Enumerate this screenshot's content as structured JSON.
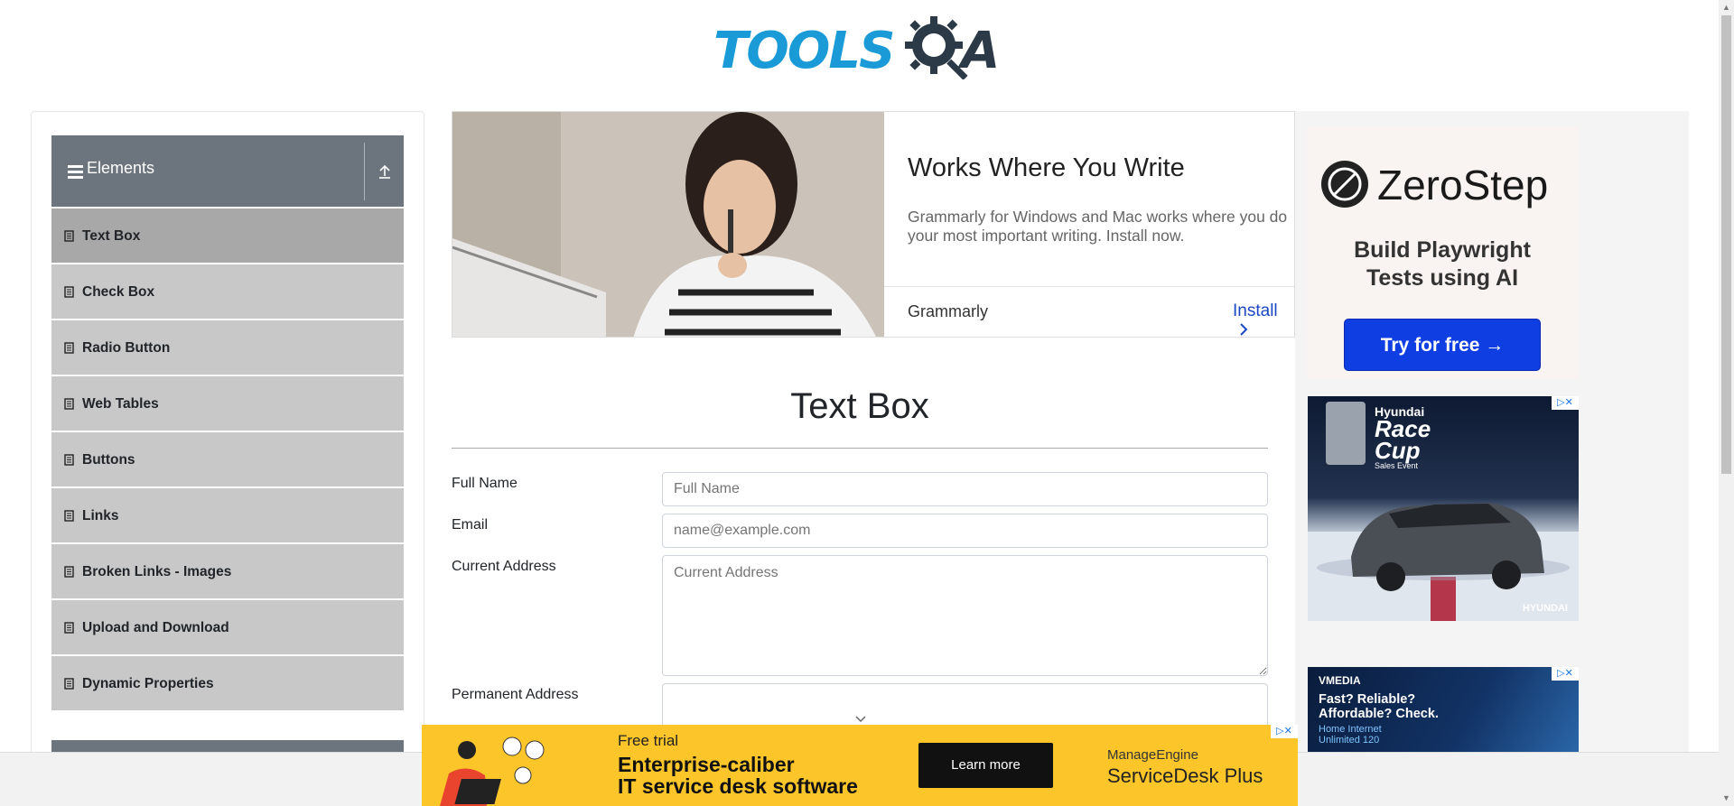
{
  "header": {
    "logo_text": "TOOLS",
    "logo_suffix": "A"
  },
  "sidebar": {
    "group_title": "Elements",
    "items": [
      {
        "label": "Text Box",
        "active": true
      },
      {
        "label": "Check Box"
      },
      {
        "label": "Radio Button"
      },
      {
        "label": "Web Tables"
      },
      {
        "label": "Buttons"
      },
      {
        "label": "Links"
      },
      {
        "label": "Broken Links - Images"
      },
      {
        "label": "Upload and Download"
      },
      {
        "label": "Dynamic Properties"
      }
    ]
  },
  "top_ad": {
    "title": "Works Where You Write",
    "description_line1": "Grammarly for Windows and Mac works where you do",
    "description_line2": "your most important writing. Install now.",
    "brand": "Grammarly",
    "cta": "Install"
  },
  "form": {
    "title": "Text Box",
    "full_name_label": "Full Name",
    "full_name_placeholder": "Full Name",
    "email_label": "Email",
    "email_placeholder": "name@example.com",
    "current_address_label": "Current Address",
    "current_address_placeholder": "Current Address",
    "permanent_address_label": "Permanent Address"
  },
  "right_ads": {
    "zerostep": {
      "name": "ZeroStep",
      "tagline_line1": "Build Playwright",
      "tagline_line2": "Tests using AI",
      "cta": "Try for free →"
    },
    "hyundai": {
      "badge": "Hyundai",
      "title_line1": "Race",
      "title_line2": "Cup",
      "sub": "Sales Event",
      "brand": "HYUNDAI"
    },
    "vmedia": {
      "brand": "VMEDIA",
      "headline_line1": "Fast? Reliable?",
      "headline_line2": "Affordable? Check.",
      "sub_line1": "Home Internet",
      "sub_line2": "Unlimited 120"
    },
    "close_label": "▷✕"
  },
  "bottom_ad": {
    "free_trial": "Free trial",
    "line1": "Enterprise-caliber",
    "line2": "IT service desk software",
    "cta": "Learn more",
    "brand_small": "ManageEngine",
    "brand_product": "ServiceDesk Plus",
    "close_label": "▷✕"
  },
  "colors": {
    "sidebar_header": "#6c757d",
    "sidebar_item": "#c8c8c8",
    "brand_blue": "#1a9bd7",
    "cta_blue": "#0f3ee3",
    "bottom_ad_bg": "#fcc52a"
  },
  "icons": [
    "menu-icon",
    "collapse-up-icon",
    "page-icon",
    "gear-icon",
    "chevron-right-icon",
    "dropdown-chevron-icon"
  ]
}
